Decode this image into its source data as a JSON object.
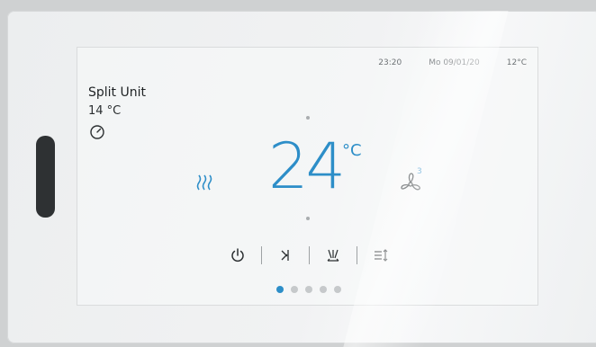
{
  "status_bar": {
    "time": "23:20",
    "date": "Mo 09/01/20",
    "outdoor_temp": "12°C"
  },
  "unit": {
    "name": "Split Unit",
    "current_temp": "14 °C"
  },
  "setpoint": {
    "value": "24",
    "unit": "°C"
  },
  "fan": {
    "level": "3"
  },
  "mode_icon": "heat-waves-icon",
  "toolbar": [
    "power-icon",
    "swing-off-icon",
    "airflow-icon",
    "louver-icon"
  ],
  "pager": {
    "count": 5,
    "active": 1
  },
  "accent_color": "#2d8ec8"
}
